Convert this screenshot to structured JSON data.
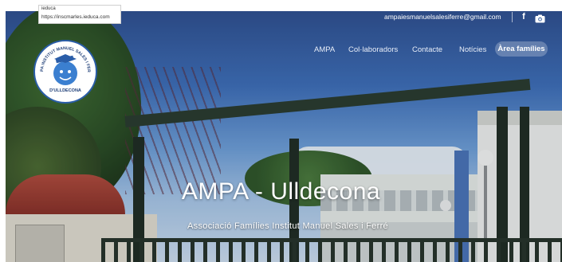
{
  "status_tooltip": {
    "line1": "ieduca",
    "url": "https://inscmarles.ieduca.com"
  },
  "topbar": {
    "email": "ampaiesmanuelsalesiferre@gmail.com",
    "icons": [
      "facebook-icon",
      "camera-icon"
    ]
  },
  "logo": {
    "ring_text": "AMPA INSTITUT MANUEL SALES I FERRÉ",
    "place": "D'ULLDECONA"
  },
  "nav": {
    "items": [
      {
        "label": "AMPA"
      },
      {
        "label": "Col·laboradors"
      },
      {
        "label": "Contacte"
      },
      {
        "label": "Notícies"
      },
      {
        "label": "Àrea famílies"
      }
    ],
    "active_index": 4
  },
  "hero": {
    "title": "AMPA - Ulldecona",
    "subtitle": "Associació Famílies Institut Manuel Sales i Ferré"
  },
  "colors": {
    "logo_border": "#2a5da8",
    "logo_face": "#3b7fd0",
    "text": "#ffffff"
  }
}
